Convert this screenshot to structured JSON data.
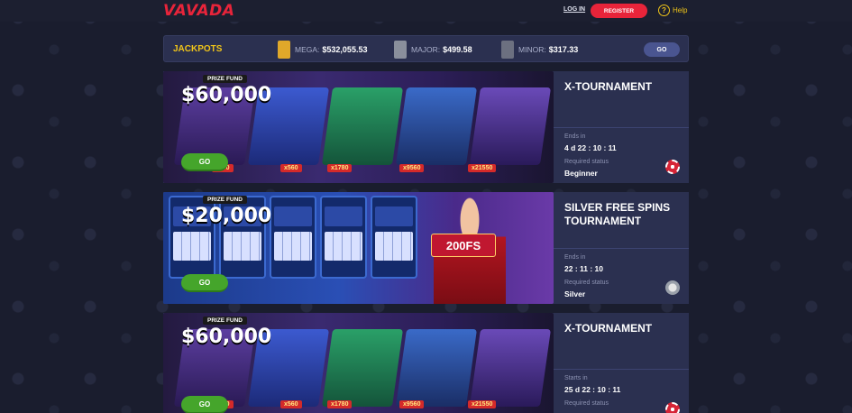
{
  "header": {
    "logo": "VAVADA",
    "login": "LOG IN",
    "register": "REGISTER",
    "help": "Help"
  },
  "jackpots": {
    "title": "JACKPOTS",
    "items": [
      {
        "label": "MEGA:",
        "value": "$532,055.53",
        "color": "#e0a82a"
      },
      {
        "label": "MAJOR:",
        "value": "$499.58",
        "color": "#8a8f9c"
      },
      {
        "label": "MINOR:",
        "value": "$317.33",
        "color": "#6c7080"
      }
    ],
    "go": "GO"
  },
  "tournaments": [
    {
      "banner": {
        "prize_label": "PRIZE FUND",
        "prize": "$60,000",
        "go": "GO",
        "multipliers": [
          "x100",
          "x560",
          "x1780",
          "x9560",
          "x21550"
        ]
      },
      "title": "X-TOURNAMENT",
      "when_label": "Ends in",
      "when_value": "4 d 22 : 10 : 11",
      "status_label": "Required status",
      "status_value": "Beginner",
      "status_icon": "red-chip-icon"
    },
    {
      "banner": {
        "prize_label": "PRIZE FUND",
        "prize": "$20,000",
        "go": "GO",
        "badge": "200FS"
      },
      "title": "SILVER FREE SPINS TOURNAMENT",
      "when_label": "Ends in",
      "when_value": "22 : 11 : 10",
      "status_label": "Required status",
      "status_value": "Silver",
      "status_icon": "silver-chip-icon"
    },
    {
      "banner": {
        "prize_label": "PRIZE FUND",
        "prize": "$60,000",
        "go": "GO",
        "multipliers": [
          "x100",
          "x560",
          "x1780",
          "x9560",
          "x21550"
        ]
      },
      "title": "X-TOURNAMENT",
      "when_label": "Starts in",
      "when_value": "25 d 22 : 10 : 11",
      "status_label": "Required status",
      "status_value": "",
      "status_icon": "red-chip-icon"
    }
  ]
}
